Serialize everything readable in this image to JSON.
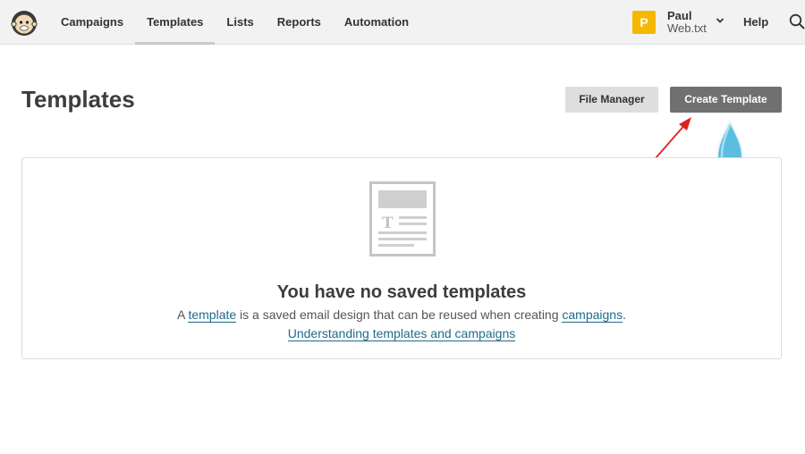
{
  "nav": {
    "items": [
      {
        "label": "Campaigns",
        "active": false
      },
      {
        "label": "Templates",
        "active": true
      },
      {
        "label": "Lists",
        "active": false
      },
      {
        "label": "Reports",
        "active": false
      },
      {
        "label": "Automation",
        "active": false
      }
    ],
    "account": {
      "initial": "P",
      "name": "Paul",
      "org": "Web.txt"
    },
    "help_label": "Help",
    "icons": {
      "logo": "mailchimp-logo",
      "search": "search-icon",
      "chevron": "chevron-down-icon"
    }
  },
  "header": {
    "title": "Templates",
    "file_manager_label": "File Manager",
    "create_template_label": "Create Template"
  },
  "empty_state": {
    "icon": "template-document-icon",
    "title": "You have no saved templates",
    "desc_prefix": "A ",
    "desc_link": "template",
    "desc_middle": " is a saved email design that can be reused when creating ",
    "desc_link2": "campaigns",
    "desc_suffix": ".",
    "help_link": "Understanding templates and campaigns"
  },
  "colors": {
    "topbar_bg": "#f2f2f2",
    "avatar_bg": "#f5b800",
    "primary_button": "#707070",
    "secondary_button": "#dedede",
    "link": "#1f6a8a",
    "annotation_arrow": "#e02020",
    "annotation_marker": "#5bbde0"
  }
}
